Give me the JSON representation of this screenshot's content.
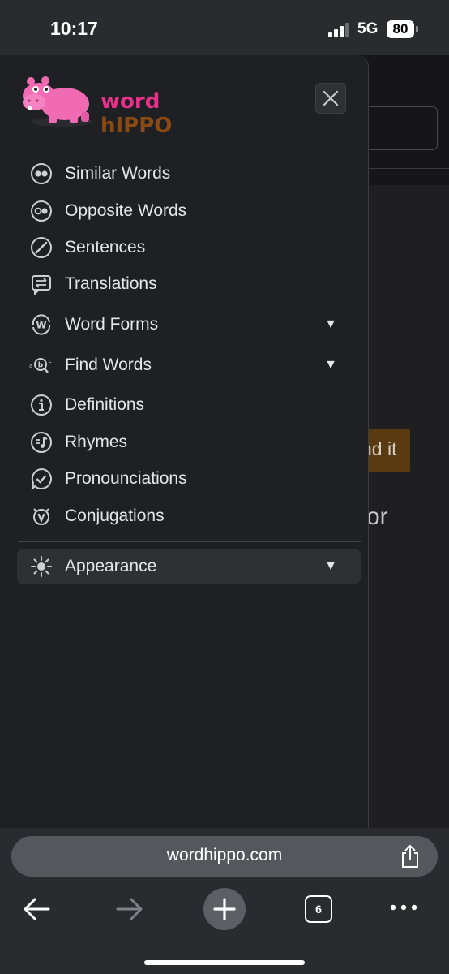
{
  "status": {
    "time": "10:17",
    "network": "5G",
    "battery": "80"
  },
  "background_page": {
    "button_fragment": "nd it",
    "text_fragment": "or"
  },
  "logo": {
    "word": "word",
    "hippo": "hIPPO"
  },
  "menu": {
    "items": [
      {
        "label": "Similar Words",
        "icon": "similar-words-icon"
      },
      {
        "label": "Opposite Words",
        "icon": "opposite-words-icon"
      },
      {
        "label": "Sentences",
        "icon": "sentences-icon"
      },
      {
        "label": "Translations",
        "icon": "translations-icon"
      },
      {
        "label": "Word Forms",
        "icon": "word-forms-icon",
        "caret": "▼"
      },
      {
        "label": "Find Words",
        "icon": "find-words-icon",
        "caret": "▼"
      },
      {
        "label": "Definitions",
        "icon": "definitions-icon"
      },
      {
        "label": "Rhymes",
        "icon": "rhymes-icon"
      },
      {
        "label": "Pronounciations",
        "icon": "pronounciations-icon"
      },
      {
        "label": "Conjugations",
        "icon": "conjugations-icon"
      }
    ],
    "appearance": {
      "label": "Appearance",
      "caret": "▼"
    }
  },
  "browser": {
    "url": "wordhippo.com",
    "tab_count": "6"
  },
  "colors": {
    "logo_word": "#e8308c",
    "logo_hippo": "#8a4a12",
    "hippo_pink": "#f06bb4"
  }
}
